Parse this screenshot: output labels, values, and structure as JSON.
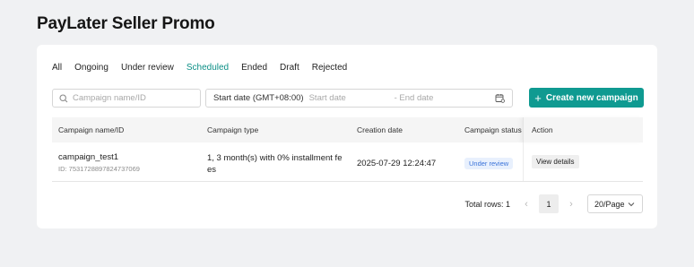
{
  "page": {
    "title": "PayLater Seller Promo"
  },
  "tabs": [
    {
      "label": "All"
    },
    {
      "label": "Ongoing"
    },
    {
      "label": "Under review"
    },
    {
      "label": "Scheduled"
    },
    {
      "label": "Ended"
    },
    {
      "label": "Draft"
    },
    {
      "label": "Rejected"
    }
  ],
  "filters": {
    "search_placeholder": "Campaign name/ID",
    "date_label": "Start date (GMT+08:00)",
    "start_placeholder": "Start date",
    "end_placeholder": "- End date"
  },
  "create_button": "Create new campaign",
  "table": {
    "columns": [
      "Campaign name/ID",
      "Campaign type",
      "Creation date",
      "Campaign status",
      "Action"
    ],
    "rows": [
      {
        "name": "campaign_test1",
        "id": "ID: 7531728897824737069",
        "type": "1, 3 month(s) with 0% installment fees",
        "created": "2025-07-29 12:24:47",
        "status": "Under review",
        "action": "View details"
      }
    ]
  },
  "pagination": {
    "total_label": "Total rows: 1",
    "current_page": "1",
    "prev": "‹",
    "next": "›",
    "page_size": "20/Page"
  },
  "colors": {
    "accent": "#0f9a91",
    "active_tab": "#0c8f86",
    "status_badge": "#3a73d9"
  }
}
